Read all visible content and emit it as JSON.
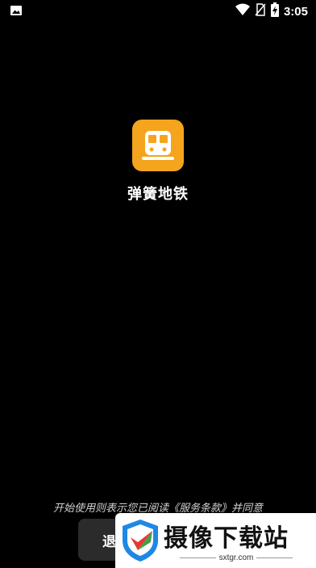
{
  "status_bar": {
    "time": "3:05",
    "icons": [
      "image-icon",
      "wifi-icon",
      "no-sim-icon",
      "battery-charging-icon"
    ]
  },
  "app": {
    "name": "弹簧地铁",
    "icon": "subway-train-icon",
    "icon_color": "#f4a51d"
  },
  "consent_text": "开始使用则表示您已阅读《服务条款》并同意",
  "buttons": {
    "exit_label": "退"
  },
  "watermark": {
    "title": "摄像下载站",
    "domain": "sxtgr.com"
  }
}
